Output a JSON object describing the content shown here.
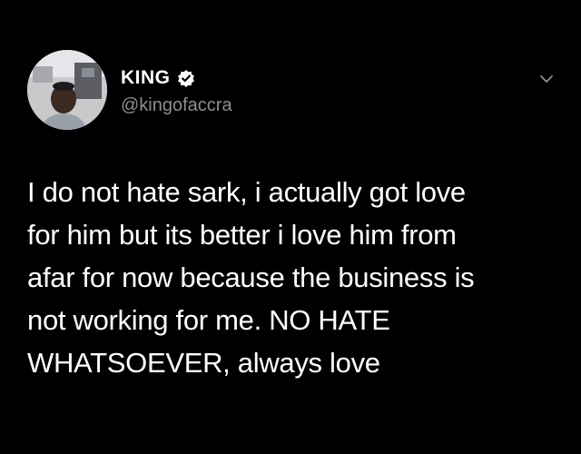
{
  "tweet": {
    "author": {
      "display_name": "KING",
      "handle": "@kingofaccra",
      "verified": true,
      "avatar_icon": "profile-photo"
    },
    "menu_icon": "chevron-down-icon",
    "text": "I do not hate sark, i actually got love\nfor him but its better i love him from\nafar for now because the business is\nnot working for me. NO HATE\nWHATSOEVER, always love"
  },
  "colors": {
    "background": "#000000",
    "text": "#ffffff",
    "handle": "#8e8e93"
  }
}
